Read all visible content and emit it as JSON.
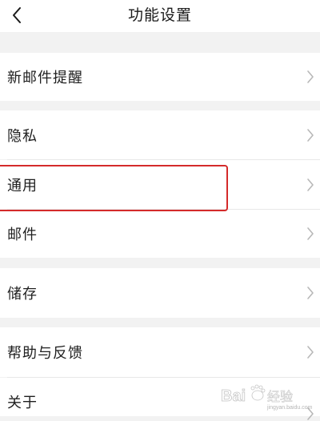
{
  "header": {
    "title": "功能设置",
    "back_icon": "chevron-left-icon"
  },
  "rows": [
    {
      "label": "新邮件提醒",
      "icon": "chevron-right-icon"
    },
    {
      "label": "隐私",
      "icon": "chevron-right-icon"
    },
    {
      "label": "通用",
      "icon": "chevron-right-icon",
      "highlighted": true
    },
    {
      "label": "邮件",
      "icon": "chevron-right-icon"
    },
    {
      "label": "储存",
      "icon": "chevron-right-icon"
    },
    {
      "label": "帮助与反馈",
      "icon": "chevron-right-icon"
    },
    {
      "label": "关于",
      "icon": "chevron-right-icon"
    }
  ],
  "colors": {
    "background": "#f2f2f2",
    "row_background": "#ffffff",
    "highlight": "#d42a2a",
    "chevron": "#b8b8b8"
  },
  "watermark": {
    "brand": "Bai",
    "paw_icon": "baidu-paw-icon",
    "suffix": "经验",
    "caption": "jingyan.baidu.com"
  }
}
